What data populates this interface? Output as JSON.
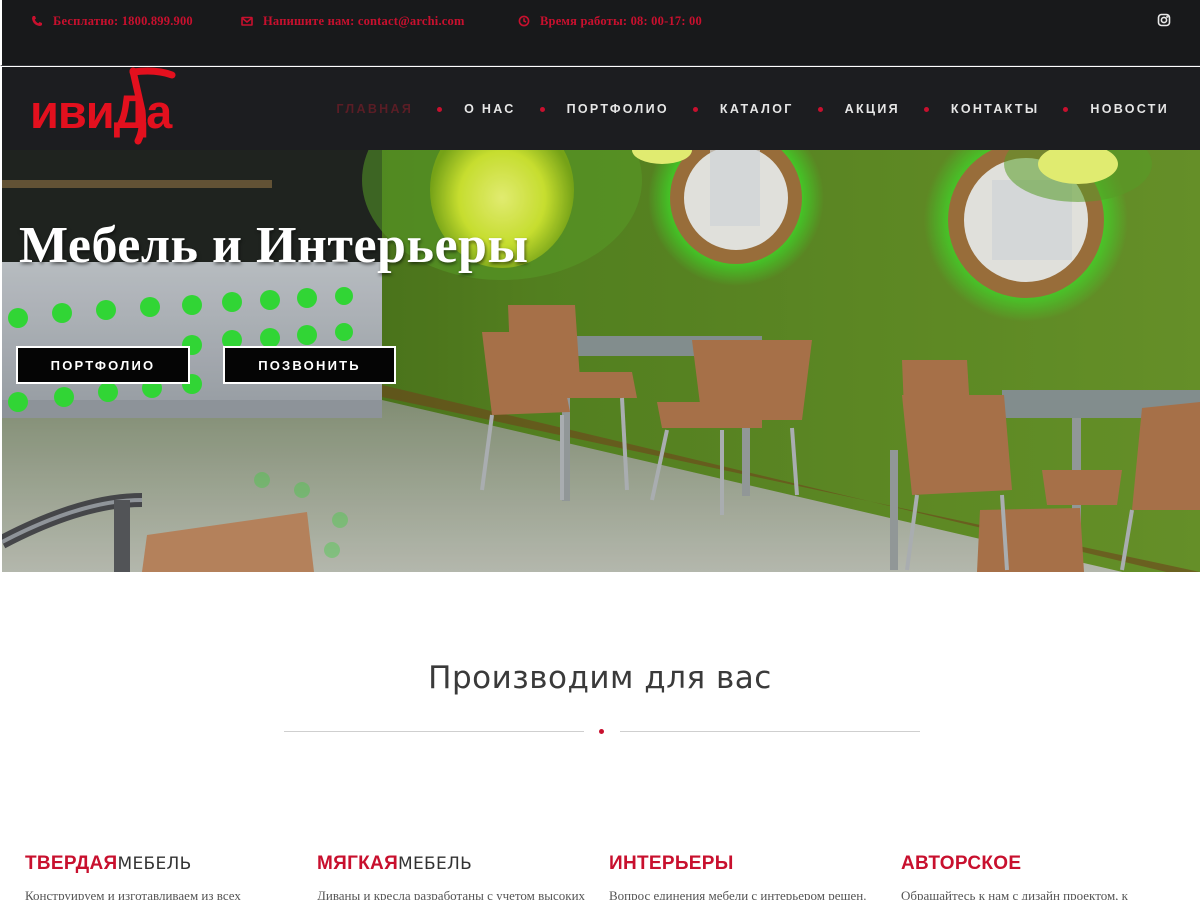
{
  "topbar": {
    "phone": "Бесплатно: 1800.899.900",
    "email": "Напишите нам: contact@archi.com",
    "hours": "Время работы: 08: 00-17: 00"
  },
  "logo": {
    "text": "ивиДа"
  },
  "nav": {
    "items": [
      "ГЛАВНАЯ",
      "О НАС",
      "ПОРТФОЛИО",
      "КАТАЛОГ",
      "АКЦИЯ",
      "КОНТАКТЫ",
      "НОВОСТИ"
    ],
    "active": "ГЛАВНАЯ"
  },
  "hero": {
    "title": "Мебель и  Интерьеры",
    "btn_portfolio": "ПОРТФОЛИО",
    "btn_call": "ПОЗВОНИТЬ"
  },
  "section": {
    "title": "Производим для вас"
  },
  "features": [
    {
      "strong": "ТВЕРДАЯ",
      "light": "МЕБЕЛЬ",
      "text": "Конструируем и изготавливаем из всех"
    },
    {
      "strong": "МЯГКАЯ",
      "light": "МЕБЕЛЬ",
      "text": "Диваны и кресла разработаны с учетом высоких"
    },
    {
      "strong": "ИНТЕРЬЕРЫ",
      "light": "",
      "text": "Вопрос единения мебели с интерьером решен."
    },
    {
      "strong": "АВТОРСКОЕ",
      "light": "",
      "text": "Обращайтесь к нам с дизайн проектом, к"
    }
  ],
  "colors": {
    "accent": "#c8102e",
    "dark": "#1c1d20",
    "hero_green": "#4f7c1e"
  },
  "icons": [
    "phone-icon",
    "mail-icon",
    "clock-icon",
    "instagram-icon"
  ]
}
